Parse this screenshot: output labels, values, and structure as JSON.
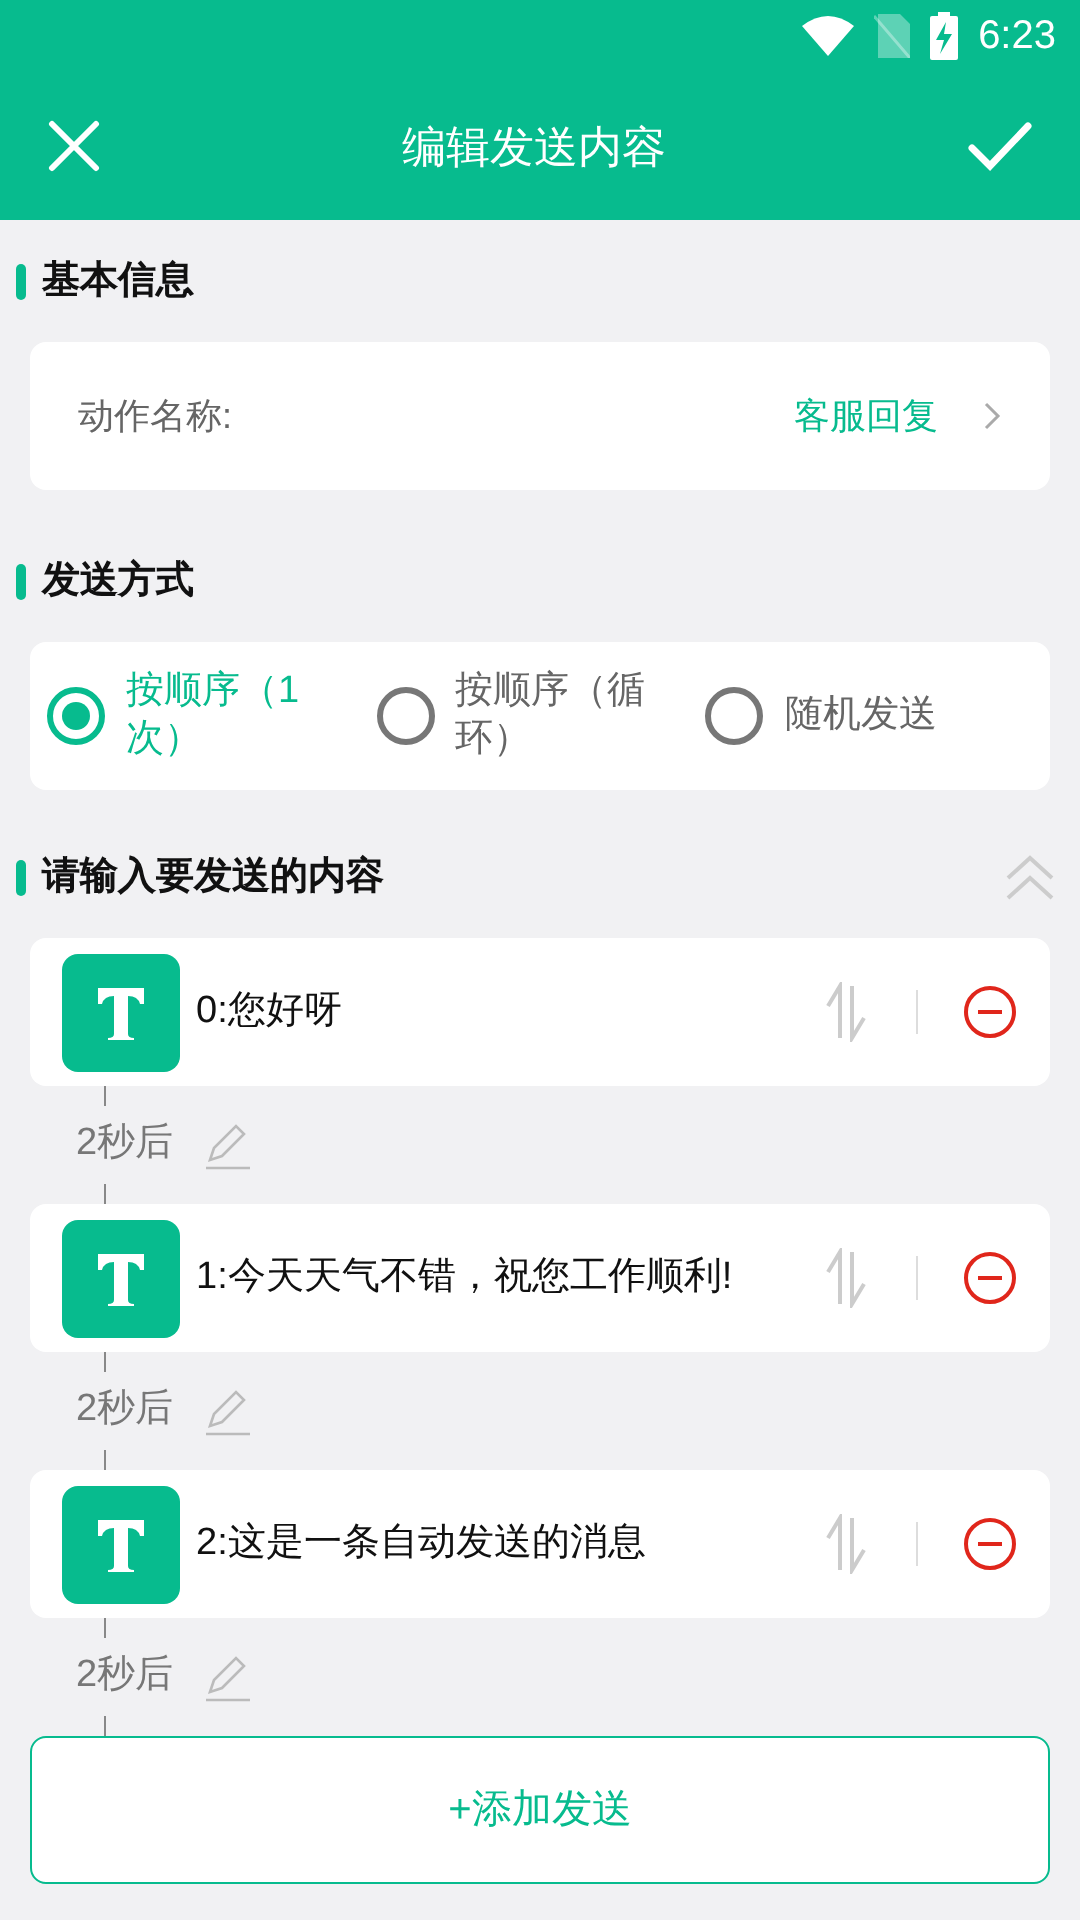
{
  "status_bar": {
    "time": "6:23"
  },
  "app_bar": {
    "title": "编辑发送内容"
  },
  "basic_info": {
    "heading": "基本信息",
    "action_label": "动作名称:",
    "action_value": "客服回复"
  },
  "send_mode": {
    "heading": "发送方式",
    "options": [
      {
        "label": "按顺序（1次）",
        "selected": true
      },
      {
        "label": "按顺序（循环）",
        "selected": false
      },
      {
        "label": "随机发送",
        "selected": false
      }
    ]
  },
  "content": {
    "heading": "请输入要发送的内容",
    "messages": [
      {
        "text": "0:您好呀",
        "delay": "2秒后"
      },
      {
        "text": "1:今天天气不错，祝您工作顺利!",
        "delay": "2秒后"
      },
      {
        "text": "2:这是一条自动发送的消息",
        "delay": "2秒后"
      }
    ],
    "add_button": "+添加发送"
  }
}
